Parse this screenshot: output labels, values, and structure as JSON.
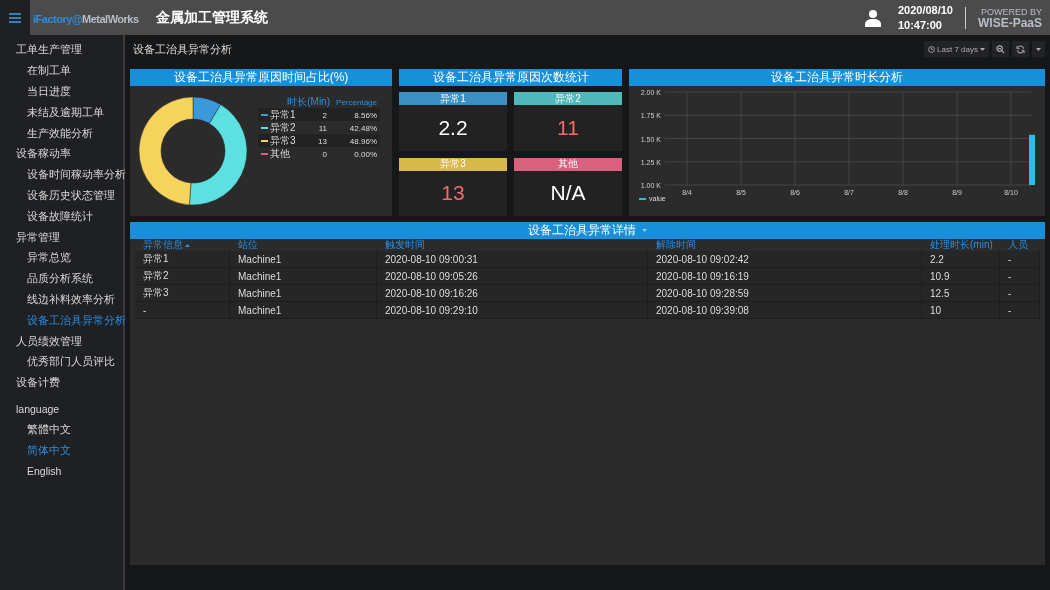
{
  "header": {
    "brand_prefix": "iFactory@",
    "brand_suffix": "MetalWorks",
    "title": "金属加工管理系统",
    "date": "2020/08/10",
    "time": "10:47:00",
    "powered_by": "POWERED BY",
    "platform": "WISE-PaaS"
  },
  "sidebar": {
    "items": [
      {
        "label": "工单生产管理",
        "selected": false,
        "children": [
          {
            "label": "在制工单",
            "selected": false
          },
          {
            "label": "当日进度",
            "selected": false
          },
          {
            "label": "未结及逾期工单",
            "selected": false
          },
          {
            "label": "生产效能分析",
            "selected": false
          }
        ]
      },
      {
        "label": "设备稼动率",
        "selected": false,
        "children": [
          {
            "label": "设备时间稼动率分析",
            "selected": false
          },
          {
            "label": "设备历史状态管理",
            "selected": false
          },
          {
            "label": "设备故障统计",
            "selected": false
          }
        ]
      },
      {
        "label": "异常管理",
        "selected": false,
        "children": [
          {
            "label": "异常总览",
            "selected": false
          },
          {
            "label": "品质分析系统",
            "selected": false
          },
          {
            "label": "线边补料效率分析",
            "selected": false
          },
          {
            "label": "设备工治具异常分析",
            "selected": true
          }
        ]
      },
      {
        "label": "人员绩效管理",
        "selected": false,
        "children": [
          {
            "label": "优秀部门人员评比",
            "selected": false
          }
        ]
      },
      {
        "label": "设备计费",
        "selected": false
      }
    ],
    "language": {
      "label": "language",
      "children": [
        {
          "label": "繁體中文",
          "selected": false
        },
        {
          "label": "简体中文",
          "selected": true
        },
        {
          "label": "English",
          "selected": false
        }
      ]
    }
  },
  "page": {
    "title": "设备工治具异常分析",
    "time_range": "Last 7 days"
  },
  "donut_panel": {
    "title": "设备工治具异常原因时间占比(%)",
    "minutes_header": "时长(Min)",
    "chart_data": {
      "type": "donut",
      "categories": [
        "异常1",
        "异常2",
        "异常3",
        "其他"
      ],
      "series": [
        {
          "name": "Percentage",
          "values": [
            8.56,
            42.48,
            48.96,
            0
          ]
        }
      ]
    },
    "legend": [
      {
        "minutes": "2",
        "percentage": "8.56%",
        "color": "#3a9ad9"
      },
      {
        "minutes": "11",
        "percentage": "42.48%",
        "color": "#5ce0e0"
      },
      {
        "minutes": "13",
        "percentage": "48.96%",
        "color": "#f5d35c"
      },
      {
        "minutes": "0",
        "percentage": "0.00%",
        "color": "#e0607e"
      }
    ]
  },
  "count_panel": {
    "title": "设备工治具异常原因次数统计",
    "cards": [
      {
        "label": "异常1",
        "value": "2.2",
        "color": "#3a8fc4",
        "alert": false
      },
      {
        "label": "异常2",
        "value": "11",
        "color": "#4fb8b8",
        "alert": true
      },
      {
        "label": "异常3",
        "value": "13",
        "color": "#d9b84a",
        "alert": true
      },
      {
        "label": "其他",
        "value": "N/A",
        "color": "#d9607e",
        "alert": false
      }
    ]
  },
  "duration_panel": {
    "title": "设备工治具异常时长分析",
    "chart_data": {
      "type": "bar",
      "grid": true,
      "categories": [
        "8/4",
        "8/5",
        "8/6",
        "8/7",
        "8/8",
        "8/9",
        "8/10"
      ],
      "series": [
        {
          "name": "value",
          "color": "#2bbde8",
          "values": [
            null,
            null,
            null,
            null,
            null,
            null,
            1540
          ]
        }
      ],
      "ylim": [
        1000,
        2000
      ],
      "yticks": [
        {
          "value": 1000,
          "label": "1.00 K"
        },
        {
          "value": 1250,
          "label": "1.25 K"
        },
        {
          "value": 1500,
          "label": "1.50 K"
        },
        {
          "value": 1750,
          "label": "1.75 K"
        },
        {
          "value": 2000,
          "label": "2.00 K"
        }
      ]
    }
  },
  "table": {
    "title": "设备工治具异常详情",
    "columns": [
      {
        "label": "异常信息",
        "sorted": true
      },
      {
        "label": "站位",
        "sorted": false
      },
      {
        "label": "触发时间",
        "sorted": false
      },
      {
        "label": "解除时间",
        "sorted": false
      },
      {
        "label": "处理时长(min)",
        "sorted": false
      },
      {
        "label": "人员",
        "sorted": false
      }
    ],
    "rows": [
      [
        "异常1",
        "Machine1",
        "2020-08-10 09:00:31",
        "2020-08-10 09:02:42",
        "2.2",
        "-"
      ],
      [
        "异常2",
        "Machine1",
        "2020-08-10 09:05:26",
        "2020-08-10 09:16:19",
        "10.9",
        "-"
      ],
      [
        "异常3",
        "Machine1",
        "2020-08-10 09:16:26",
        "2020-08-10 09:28:59",
        "12.5",
        "-"
      ],
      [
        "-",
        "Machine1",
        "2020-08-10 09:29:10",
        "2020-08-10 09:39:08",
        "10",
        "-"
      ]
    ]
  }
}
